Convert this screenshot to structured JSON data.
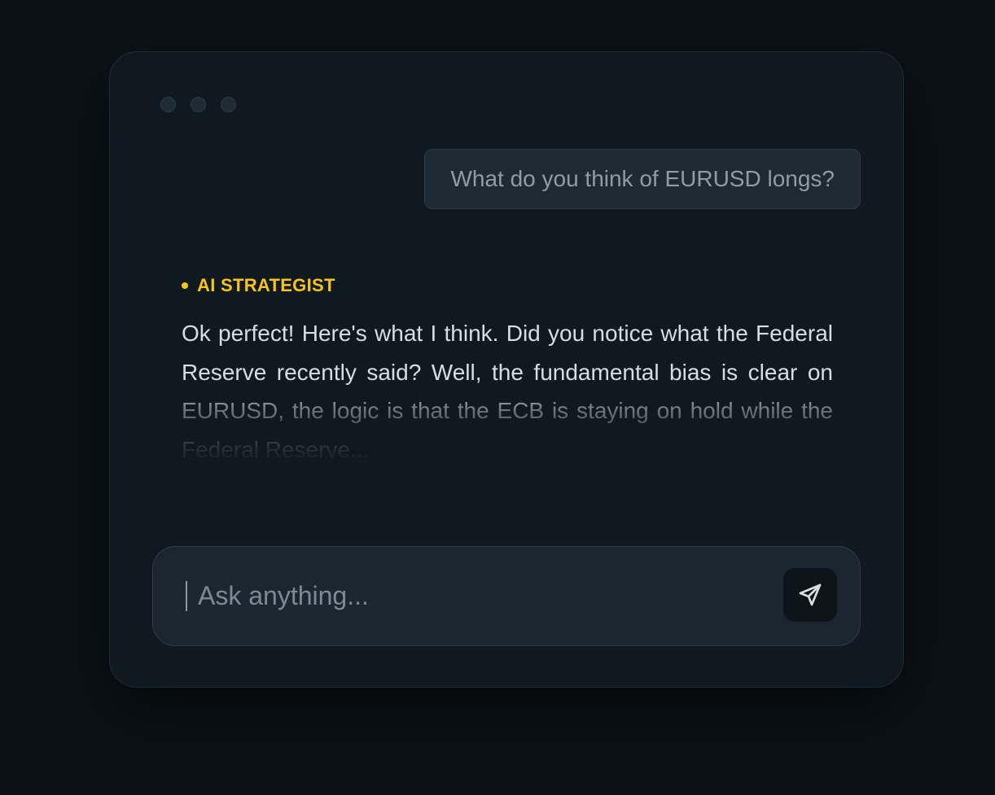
{
  "window": {
    "dots": [
      "dot",
      "dot",
      "dot"
    ]
  },
  "chat": {
    "user_message": "What do you think of EURUSD longs?",
    "assistant_label": "AI STRATEGIST",
    "assistant_message": "Ok perfect! Here's what I think. Did you notice what the Federal Reserve recently said? Well, the fundamental bias is clear on EURUSD, the logic is that the ECB is staying on hold while the Federal Reserve..."
  },
  "composer": {
    "placeholder": "Ask anything...",
    "value": "",
    "send_icon": "send-icon"
  },
  "colors": {
    "accent": "#f5c518",
    "background": "#0b1217",
    "panel": "#111920"
  }
}
